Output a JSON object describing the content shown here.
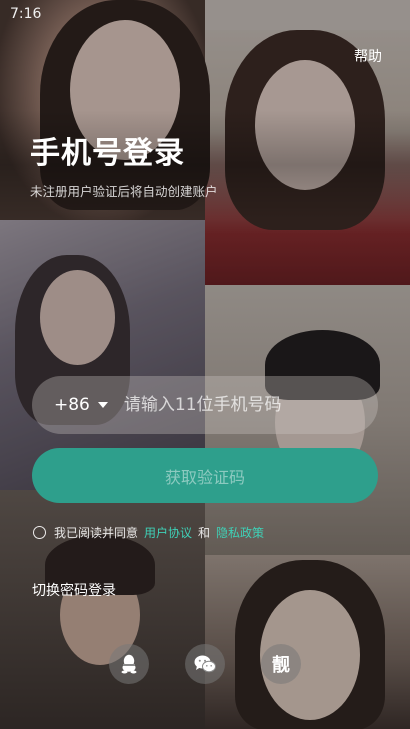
{
  "status_bar": {
    "time": "7:16"
  },
  "header": {
    "help_label": "帮助"
  },
  "login": {
    "title": "手机号登录",
    "subtitle": "未注册用户验证后将自动创建账户",
    "country_code": "+86",
    "phone_placeholder": "请输入11位手机号码",
    "phone_value": "",
    "get_code_label": "获取验证码",
    "get_code_color": "#2e9f8c"
  },
  "agreement": {
    "prefix": "我已阅读并同意",
    "user_agreement": "用户协议",
    "and": "和",
    "privacy_policy": "隐私政策",
    "link_color": "#3fd1b7",
    "checked": false
  },
  "switch_login": {
    "label": "切换密码登录"
  },
  "social_logins": [
    {
      "icon": "qq-icon"
    },
    {
      "icon": "wechat-icon"
    },
    {
      "icon": "liang-app-icon",
      "glyph": "靓"
    }
  ]
}
